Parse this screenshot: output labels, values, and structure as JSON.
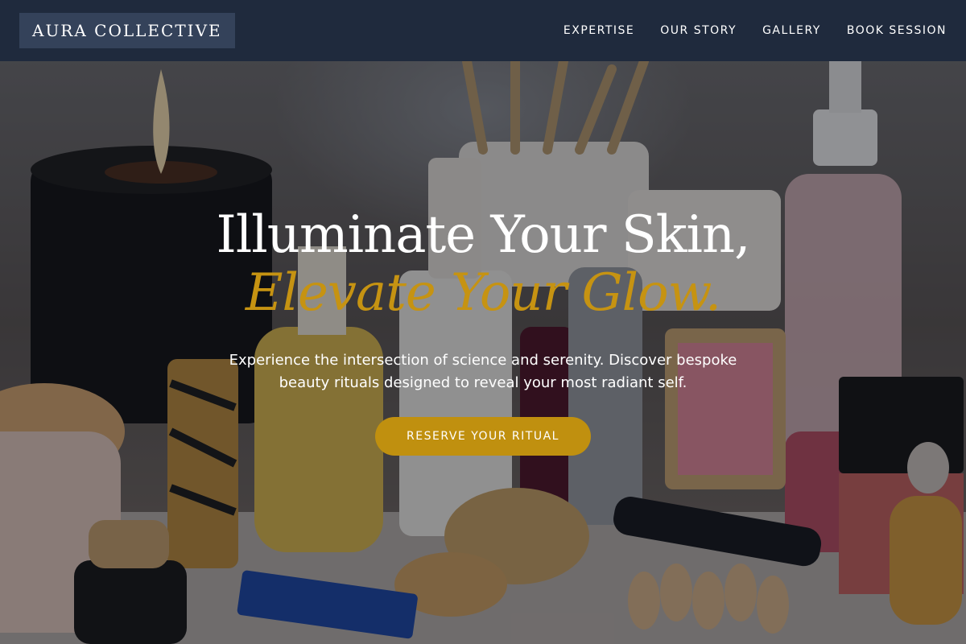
{
  "brand": {
    "name": "AURA COLLECTIVE"
  },
  "nav": {
    "items": [
      {
        "label": "EXPERTISE"
      },
      {
        "label": "OUR STORY"
      },
      {
        "label": "GALLERY"
      },
      {
        "label": "BOOK SESSION"
      }
    ]
  },
  "hero": {
    "headline_line1": "Illuminate Your Skin,",
    "headline_line2": "Elevate Your Glow.",
    "subtext": "Experience the intersection of science and serenity. Discover bespoke beauty rituals designed to reveal your most radiant self.",
    "cta_label": "RESERVE YOUR RITUAL",
    "background_image": "beauty-products-vanity-photo",
    "overlay_color": "#0a0c12"
  },
  "colors": {
    "header_bg": "#1f2a3d",
    "logo_bg": "#34425a",
    "accent_gold": "#c69312",
    "cta_bg": "#c0900f",
    "text_white": "#ffffff"
  }
}
